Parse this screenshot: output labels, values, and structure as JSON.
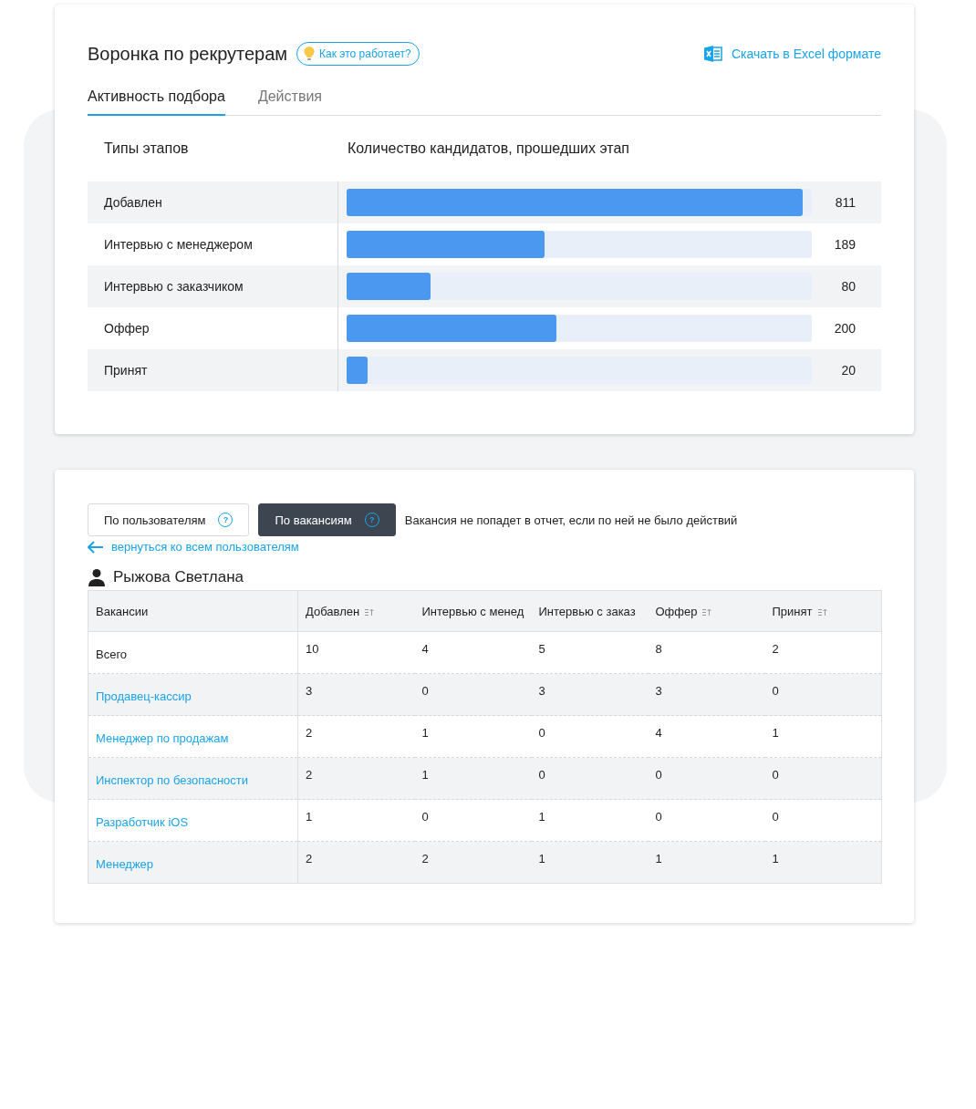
{
  "funnel": {
    "title": "Воронка по рекрутерам",
    "help_link": "Как это работает?",
    "export_link": "Скачать в Excel формате",
    "tabs": [
      {
        "label": "Активность подбора",
        "selected": true
      },
      {
        "label": "Действия",
        "selected": false
      }
    ],
    "columns": [
      "Типы этапов",
      "Количество кандидатов, прошедших этап"
    ],
    "stages": [
      {
        "name": "Добавлен",
        "level": 0.98,
        "count": "811"
      },
      {
        "name": "Интервью с менеджером",
        "level": 0.425,
        "count": "189"
      },
      {
        "name": "Интервью с заказчиком",
        "level": 0.18,
        "count": "80"
      },
      {
        "name": "Оффер",
        "level": 0.45,
        "count": "200"
      },
      {
        "name": "Принят",
        "level": 0.045,
        "count": "20"
      }
    ]
  },
  "report": {
    "toggles": [
      {
        "label": "По пользователям",
        "hint": "?",
        "selected": false
      },
      {
        "label": "По вакансиям",
        "hint": "?",
        "selected": true
      }
    ],
    "note": "Вакансия не попадет в отчет, если по ней не было действий",
    "back_link": "вернуться ко всем пользователям",
    "user": "Рыжова Светлана",
    "table": {
      "columns": [
        {
          "label": "Вакансии",
          "sortable": false
        },
        {
          "label": "Добавлен",
          "sortable": true
        },
        {
          "label": "Интервью с менед",
          "sortable": false
        },
        {
          "label": "Интервью с заказ",
          "sortable": false
        },
        {
          "label": "Оффер",
          "sortable": true
        },
        {
          "label": "Принят",
          "sortable": true
        }
      ],
      "rows": [
        {
          "kind": "total",
          "name": "Всего",
          "values": [
            "10",
            "4",
            "5",
            "8",
            "2"
          ]
        },
        {
          "kind": "vacancy",
          "name": "Продавец-кассир",
          "values": [
            "3",
            "0",
            "3",
            "3",
            "0"
          ]
        },
        {
          "kind": "vacancy",
          "name": "Менеджер по продажам",
          "values": [
            "2",
            "1",
            "0",
            "4",
            "1"
          ]
        },
        {
          "kind": "vacancy",
          "name": "Инспектор по безопасности",
          "values": [
            "2",
            "1",
            "0",
            "0",
            "0"
          ]
        },
        {
          "kind": "vacancy",
          "name": "Разработчик iOS",
          "values": [
            "1",
            "0",
            "1",
            "0",
            "0"
          ]
        },
        {
          "kind": "vacancy",
          "name": "Менеджер",
          "values": [
            "2",
            "2",
            "1",
            "1",
            "1"
          ]
        }
      ]
    }
  }
}
